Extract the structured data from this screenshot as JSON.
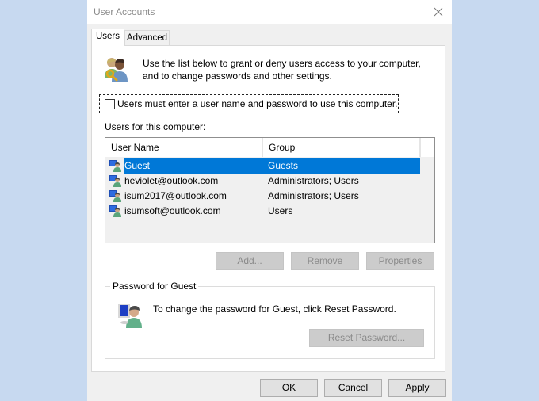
{
  "window": {
    "title": "User Accounts",
    "close_icon": "close-icon"
  },
  "tabs": [
    {
      "label": "Users",
      "active": true
    },
    {
      "label": "Advanced",
      "active": false
    }
  ],
  "intro": {
    "icon": "users-key-icon",
    "text": "Use the list below to grant or deny users access to your computer, and to change passwords and other settings."
  },
  "require_login": {
    "label": "Users must enter a user name and password to use this computer.",
    "checked": false
  },
  "users_section": {
    "label": "Users for this computer:",
    "columns": [
      "User Name",
      "Group"
    ],
    "rows": [
      {
        "name": "Guest",
        "group": "Guests",
        "selected": true
      },
      {
        "name": "heviolet@outlook.com",
        "group": "Administrators; Users",
        "selected": false
      },
      {
        "name": "isum2017@outlook.com",
        "group": "Administrators; Users",
        "selected": false
      },
      {
        "name": "isumsoft@outlook.com",
        "group": "Users",
        "selected": false
      }
    ],
    "buttons": {
      "add": "Add...",
      "remove": "Remove",
      "properties": "Properties"
    }
  },
  "password_group": {
    "legend": "Password for Guest",
    "icon": "user-computer-icon",
    "text": "To change the password for Guest, click Reset Password.",
    "reset_button": "Reset Password..."
  },
  "footer": {
    "ok": "OK",
    "cancel": "Cancel",
    "apply": "Apply"
  },
  "colors": {
    "selection": "#0078d7",
    "desktop_bg": "#c7d9f0",
    "dialog_bg": "#f0f0f0"
  }
}
